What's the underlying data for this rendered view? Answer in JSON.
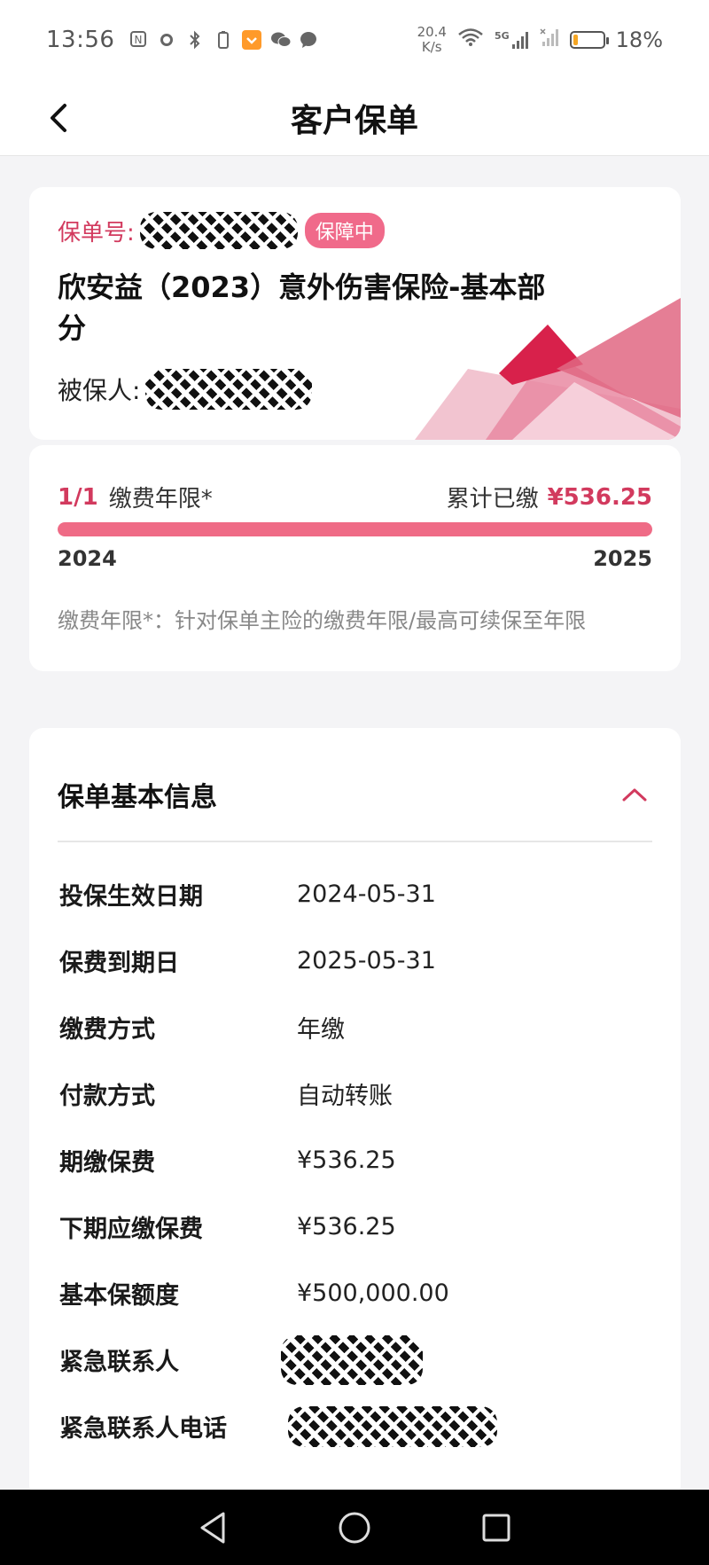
{
  "status_bar": {
    "time": "13:56",
    "net_speed_value": "20.4",
    "net_speed_unit": "K/s",
    "network_label": "5G",
    "battery_percent": "18%",
    "battery_level": 0.18
  },
  "header": {
    "title": "客户保单"
  },
  "policy": {
    "policy_no_label": "保单号:",
    "status_badge": "保障中",
    "product_name": "欣安益（2023）意外伤害保险-基本部分",
    "insured_label": "被保人:",
    "accent_color": "#d23a5e"
  },
  "payment": {
    "count": "1/1",
    "period_label": "缴费年限*",
    "total_label": "累计已缴",
    "total_amount": "¥536.25",
    "progress": 1.0,
    "start_year": "2024",
    "end_year": "2025",
    "note": "缴费年限*：针对保单主险的缴费年限/最高可续保至年限"
  },
  "basic_info": {
    "title": "保单基本信息",
    "rows": [
      {
        "label": "投保生效日期",
        "value": "2024-05-31"
      },
      {
        "label": "保费到期日",
        "value": "2025-05-31"
      },
      {
        "label": "缴费方式",
        "value": "年缴"
      },
      {
        "label": "付款方式",
        "value": "自动转账"
      },
      {
        "label": "期缴保费",
        "value": "¥536.25"
      },
      {
        "label": "下期应缴保费",
        "value": "¥536.25"
      },
      {
        "label": "基本保额度",
        "value": "¥500,000.00"
      },
      {
        "label": "紧急联系人",
        "value": ""
      },
      {
        "label": "紧急联系人电话",
        "value": ""
      }
    ]
  },
  "icons": {
    "back": "chevron-left-icon",
    "collapse": "chevron-up-icon",
    "nav_back": "triangle-back-icon",
    "nav_home": "circle-home-icon",
    "nav_recent": "square-recent-icon"
  }
}
